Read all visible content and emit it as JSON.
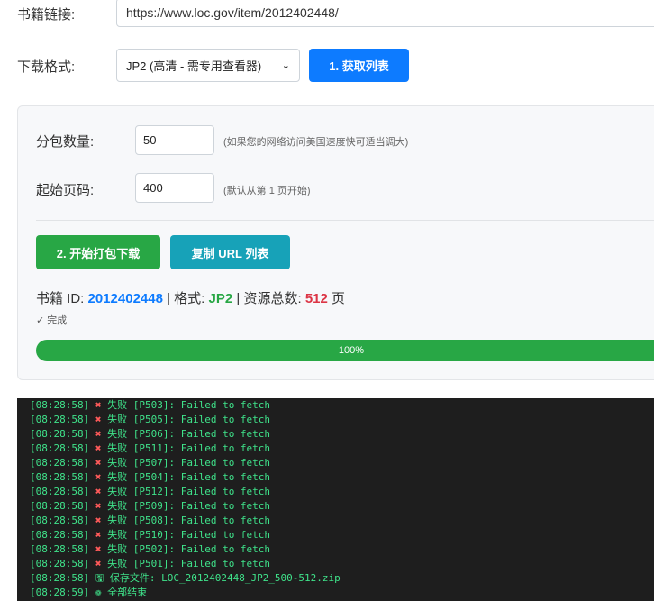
{
  "form": {
    "url_label": "书籍链接:",
    "url_value": "https://www.loc.gov/item/2012402448/",
    "format_label": "下载格式:",
    "format_value": "JP2 (高清 - 需专用查看器)",
    "fetch_button": "1. 获取列表"
  },
  "options": {
    "batch_label": "分包数量:",
    "batch_value": "50",
    "batch_hint": "(如果您的网络访问美国速度快可适当调大)",
    "start_label": "起始页码:",
    "start_value": "400",
    "start_hint": "(默认从第 1 页开始)",
    "pack_button": "2. 开始打包下载",
    "copy_button": "复制 URL 列表"
  },
  "info": {
    "id_label": "书籍 ID: ",
    "id_value": "2012402448",
    "sep1": " | 格式: ",
    "format_value": "JP2",
    "sep2": " | 资源总数: ",
    "count_value": "512",
    "count_unit": " 页",
    "status_text": "完成",
    "progress_text": "100%",
    "progress_fraction": 1.0
  },
  "log": [
    {
      "time": "[08:28:58]",
      "icon": "x-icon",
      "text": " 失败 [P503]: Failed to fetch"
    },
    {
      "time": "[08:28:58]",
      "icon": "x-icon",
      "text": " 失败 [P505]: Failed to fetch"
    },
    {
      "time": "[08:28:58]",
      "icon": "x-icon",
      "text": " 失败 [P506]: Failed to fetch"
    },
    {
      "time": "[08:28:58]",
      "icon": "x-icon",
      "text": " 失败 [P511]: Failed to fetch"
    },
    {
      "time": "[08:28:58]",
      "icon": "x-icon",
      "text": " 失败 [P507]: Failed to fetch"
    },
    {
      "time": "[08:28:58]",
      "icon": "x-icon",
      "text": " 失败 [P504]: Failed to fetch"
    },
    {
      "time": "[08:28:58]",
      "icon": "x-icon",
      "text": " 失败 [P512]: Failed to fetch"
    },
    {
      "time": "[08:28:58]",
      "icon": "x-icon",
      "text": " 失败 [P509]: Failed to fetch"
    },
    {
      "time": "[08:28:58]",
      "icon": "x-icon",
      "text": " 失败 [P508]: Failed to fetch"
    },
    {
      "time": "[08:28:58]",
      "icon": "x-icon",
      "text": " 失败 [P510]: Failed to fetch"
    },
    {
      "time": "[08:28:58]",
      "icon": "x-icon",
      "text": " 失败 [P502]: Failed to fetch"
    },
    {
      "time": "[08:28:58]",
      "icon": "x-icon",
      "text": " 失败 [P501]: Failed to fetch"
    },
    {
      "time": "[08:28:58]",
      "icon": "save-icon",
      "text": " 保存文件: LOC_2012402448_JP2_500-512.zip"
    },
    {
      "time": "[08:28:59]",
      "icon": "party-icon",
      "text": " 全部结束"
    }
  ],
  "colors": {
    "primary": "#0d7bff",
    "success": "#28a745",
    "info": "#17a2b8",
    "danger": "#dc3545",
    "console_bg": "#1e1e1e",
    "console_text": "#3fe28a"
  }
}
